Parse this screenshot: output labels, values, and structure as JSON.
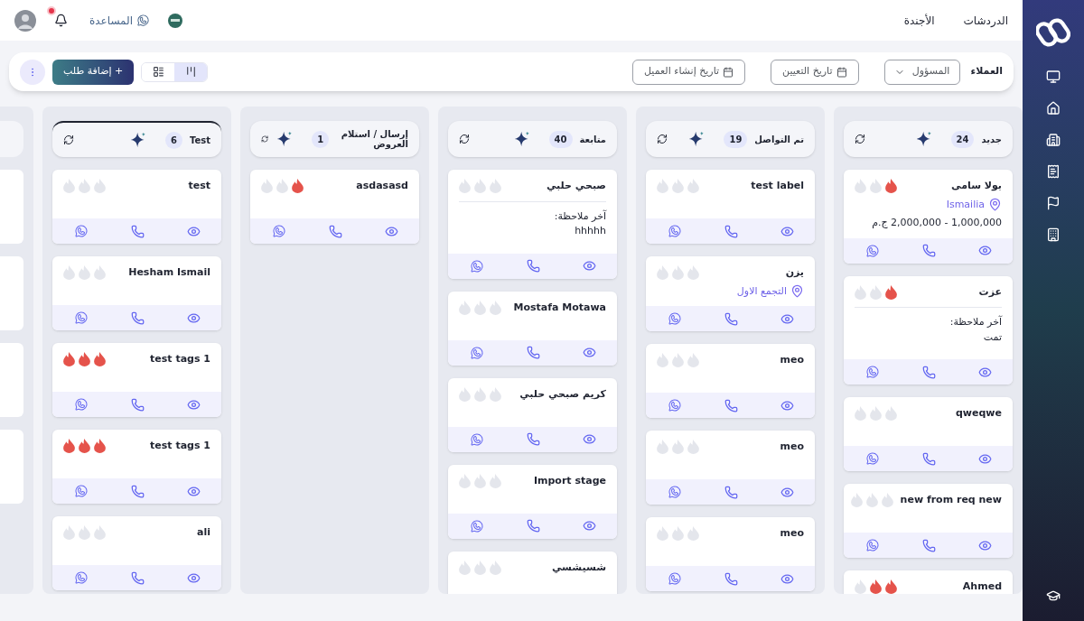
{
  "top_nav": {
    "links": [
      {
        "label": "الدردشات"
      },
      {
        "label": "الأجندة"
      }
    ],
    "help": "المساعدة",
    "has_notification": true
  },
  "toolbar": {
    "label": "العملاء",
    "owner_filter": "المسؤول",
    "date_filters": [
      "تاريخ التعيين",
      "تاريخ إنشاء العميل"
    ],
    "views": [
      {
        "kind": "kanban",
        "selected": true
      },
      {
        "kind": "list",
        "selected": false
      }
    ],
    "add_button": "+ إضافة طلب"
  },
  "columns": [
    {
      "title": "جديد",
      "count": "24",
      "selected": false,
      "cards": [
        {
          "name": "بولا سامى",
          "stars": 1,
          "location": "Ismailia",
          "price": "1,000,000 - 2,000,000 ج.م"
        },
        {
          "name": "عزت",
          "stars": 1,
          "note_label": "آخر ملاحظة:",
          "note": "تمت"
        },
        {
          "name": "qweqwe",
          "stars": 0
        },
        {
          "name": "new from req new",
          "stars": 0
        },
        {
          "name": "Ahmed",
          "stars": 2,
          "cut_off": true
        }
      ]
    },
    {
      "title": "تم التواصل",
      "count": "19",
      "selected": false,
      "cards": [
        {
          "name": "test label",
          "stars": 0
        },
        {
          "name": "يزن",
          "stars": 0,
          "location": "التجمع الاول"
        },
        {
          "name": "meo",
          "stars": 0
        },
        {
          "name": "meo",
          "stars": 0
        },
        {
          "name": "meo",
          "stars": 0
        }
      ]
    },
    {
      "title": "متابعة",
      "count": "40",
      "selected": false,
      "cards": [
        {
          "name": "صبحي حلبي",
          "stars": 0,
          "note_label": "آخر ملاحظة:",
          "note": "hhhhh"
        },
        {
          "name": "Mostafa Motawa",
          "stars": 0
        },
        {
          "name": "كريم صبحي حلبي",
          "stars": 0
        },
        {
          "name": "Import stage",
          "stars": 0
        },
        {
          "name": "شسيشسي",
          "stars": 0,
          "cut_off": true
        }
      ]
    },
    {
      "title": "إرسال / استلام العروض",
      "count": "1",
      "selected": false,
      "cards": [
        {
          "name": "asdasasd",
          "stars": 1
        }
      ]
    },
    {
      "title": "Test",
      "count": "6",
      "selected": true,
      "cards": [
        {
          "name": "test",
          "stars": 0
        },
        {
          "name": "Hesham Ismail",
          "stars": 0
        },
        {
          "name": "test tags 1",
          "stars": 3
        },
        {
          "name": "test tags 1",
          "stars": 3
        },
        {
          "name": "ali",
          "stars": 0
        }
      ]
    }
  ]
}
